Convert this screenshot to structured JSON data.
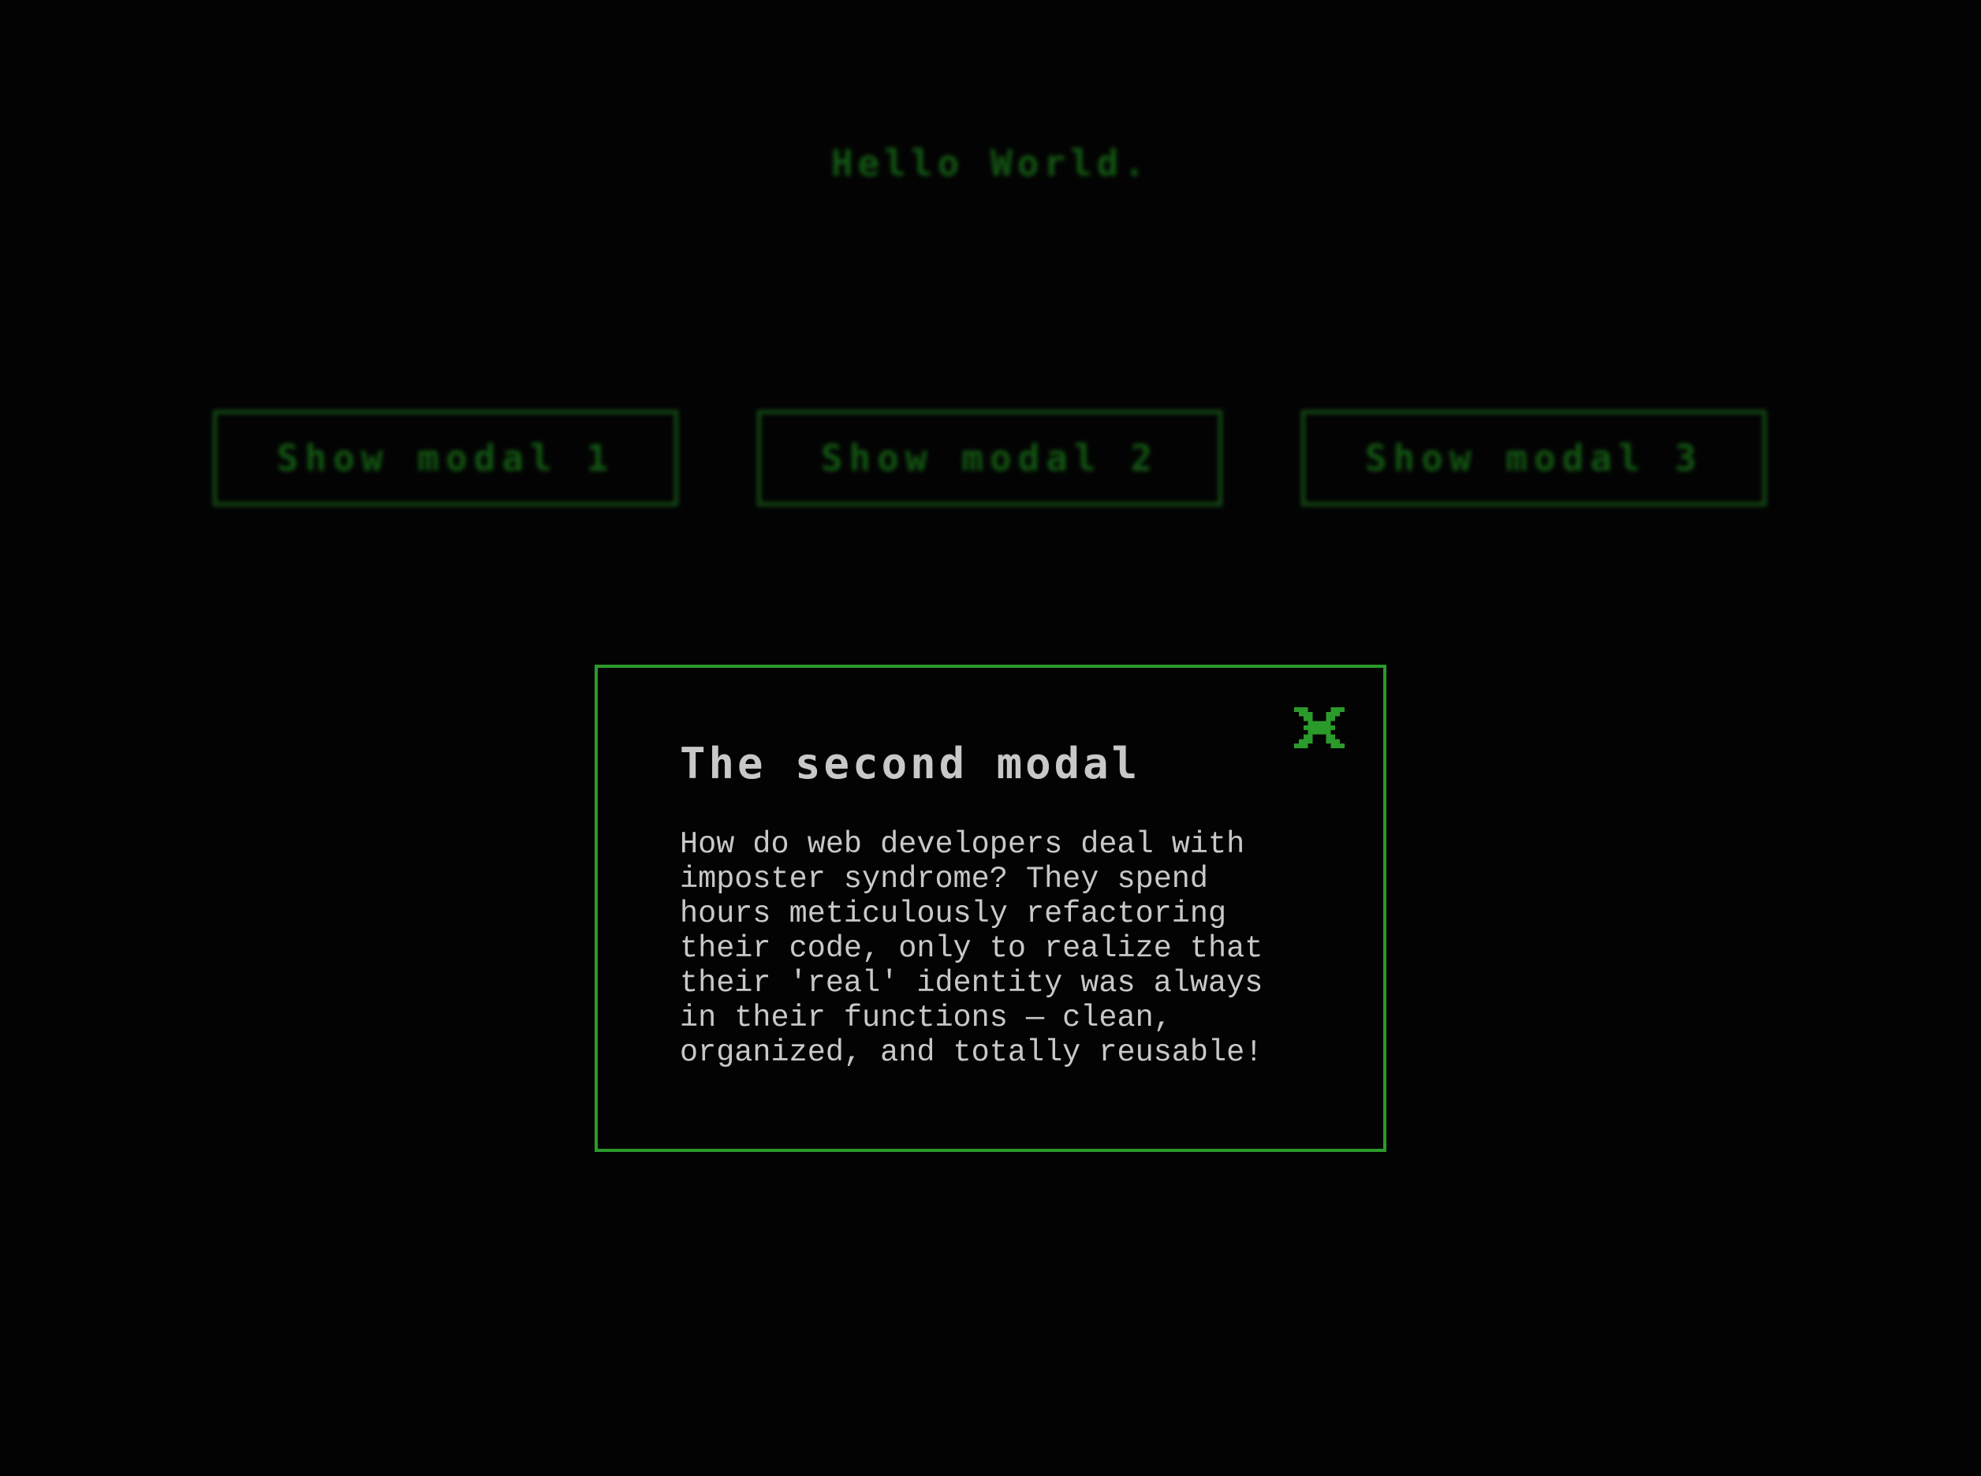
{
  "page": {
    "heading": "Hello World."
  },
  "buttons": [
    {
      "label": "Show modal 1"
    },
    {
      "label": "Show modal 2"
    },
    {
      "label": "Show modal 3"
    }
  ],
  "modal": {
    "title": "The second modal",
    "body": "How do web developers deal with imposter syndrome? They spend hours meticulously refactoring their code, only to realize that their 'real' identity was always in their functions — clean, organized, and totally reusable!",
    "close_icon": "close-icon"
  },
  "colors": {
    "background": "#030303",
    "accent": "#2a9a2a",
    "text": "#c8c8c8"
  }
}
